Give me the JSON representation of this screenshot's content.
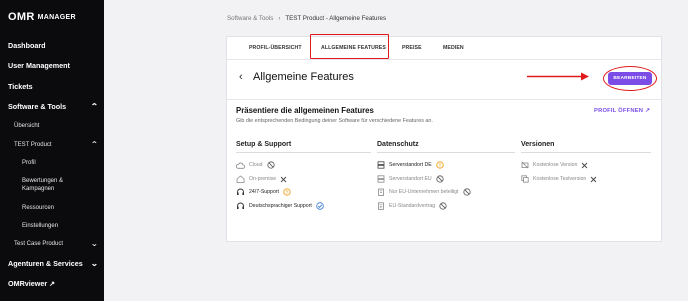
{
  "app": {
    "logo_main": "OMR",
    "logo_sub": "MANAGER"
  },
  "sidebar": {
    "items": [
      {
        "label": "Dashboard",
        "chevron": ""
      },
      {
        "label": "User Management",
        "chevron": ""
      },
      {
        "label": "Tickets",
        "chevron": ""
      },
      {
        "label": "Software & Tools",
        "chevron": "up"
      },
      {
        "label": "Übersicht",
        "chevron": ""
      },
      {
        "label": "TEST Product",
        "chevron": "up"
      },
      {
        "label": "Profil",
        "chevron": ""
      },
      {
        "label": "Bewertungen &",
        "chevron": ""
      },
      {
        "label": "Kampagnen",
        "chevron": ""
      },
      {
        "label": "Ressourcen",
        "chevron": ""
      },
      {
        "label": "Einstellungen",
        "chevron": ""
      },
      {
        "label": "Test Case Product",
        "chevron": "down"
      },
      {
        "label": "Agenturen & Services",
        "chevron": "down"
      },
      {
        "label": "OMRviewer ↗",
        "chevron": ""
      }
    ]
  },
  "breadcrumb": {
    "parent": "Software & Tools",
    "separator": "›",
    "current": "TEST Product - Allgemeine Features"
  },
  "tabs": [
    {
      "label": "PROFIL-ÜBERSICHT"
    },
    {
      "label": "ALLGEMEINE FEATURES"
    },
    {
      "label": "PREISE"
    },
    {
      "label": "MEDIEN"
    }
  ],
  "page": {
    "back_icon": "‹",
    "title": "Allgemeine Features",
    "edit_label": "BEARBEITEN"
  },
  "section": {
    "title": "Präsentiere die allgemeinen Features",
    "subtitle": "Gib die entsprechenden Bedingung deiner Software für verschiedene Features an.",
    "profile_link": "PROFIL ÖFFNEN ↗"
  },
  "columns": {
    "setup": {
      "title": "Setup & Support",
      "items": [
        {
          "icon": "cloud-icon",
          "label": "Cloud",
          "status": "blocked"
        },
        {
          "icon": "home-icon",
          "label": "On-premise",
          "status": "no"
        },
        {
          "icon": "headset-icon",
          "label": "24/7-Support",
          "status": "info"
        },
        {
          "icon": "headset-icon",
          "label": "Deutschsprachiger Support",
          "status": "yes"
        }
      ]
    },
    "privacy": {
      "title": "Datenschutz",
      "items": [
        {
          "icon": "server-icon",
          "label": "Serverstandort DE",
          "status": "info"
        },
        {
          "icon": "server-icon",
          "label": "Serverstandort EU",
          "status": "blocked"
        },
        {
          "icon": "building-icon",
          "label": "Nur EU-Unternehmen beteiligt",
          "status": "blocked"
        },
        {
          "icon": "document-icon",
          "label": "EU-Standardvertrag",
          "status": "blocked"
        }
      ]
    },
    "versions": {
      "title": "Versionen",
      "items": [
        {
          "icon": "no-tag-icon",
          "label": "Kostenlose Version",
          "status": "no"
        },
        {
          "icon": "copy-icon",
          "label": "Kostenlose Testversion",
          "status": "no"
        }
      ]
    }
  },
  "colors": {
    "accent": "#7b4de6",
    "annotation_red": "#e01a1a",
    "info": "#f0a020",
    "yes": "#3a7bd5"
  }
}
